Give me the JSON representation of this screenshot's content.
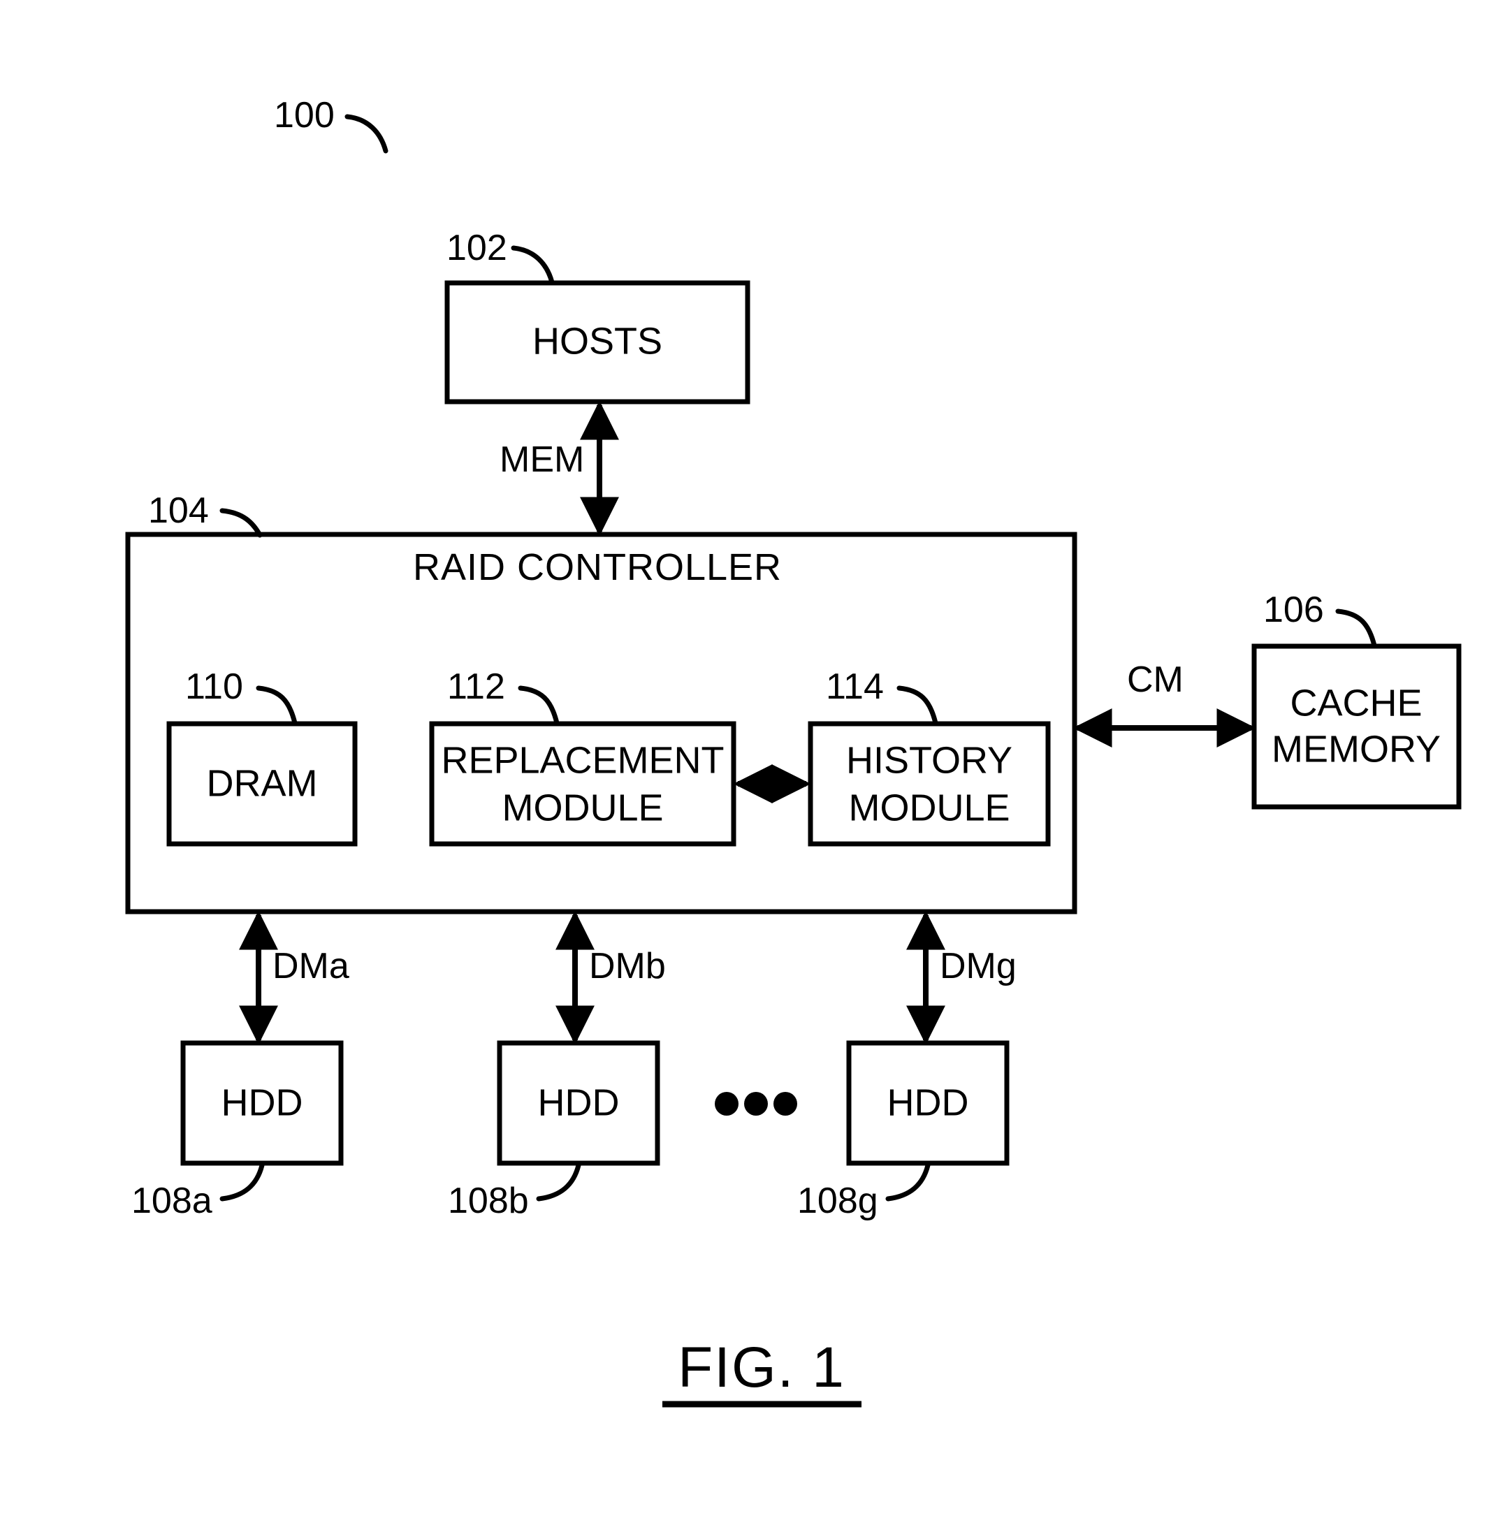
{
  "figure": {
    "caption": "FIG. 1",
    "system_ref": "100"
  },
  "blocks": {
    "hosts": {
      "label": "HOSTS",
      "ref": "102"
    },
    "raid_controller": {
      "label": "RAID CONTROLLER",
      "ref": "104"
    },
    "cache_memory": {
      "label_line1": "CACHE",
      "label_line2": "MEMORY",
      "ref": "106"
    },
    "dram": {
      "label": "DRAM",
      "ref": "110"
    },
    "replacement_module": {
      "label_line1": "REPLACEMENT",
      "label_line2": "MODULE",
      "ref": "112"
    },
    "history_module": {
      "label_line1": "HISTORY",
      "label_line2": "MODULE",
      "ref": "114"
    },
    "drives": [
      {
        "label": "HDD",
        "ref": "108a",
        "signal": "DMa"
      },
      {
        "label": "HDD",
        "ref": "108b",
        "signal": "DMb"
      },
      {
        "label": "HDD",
        "ref": "108g",
        "signal": "DMg"
      }
    ],
    "drive_ellipsis": "• • •"
  },
  "connections": {
    "hosts_to_controller": "MEM",
    "controller_to_cache": "CM",
    "drive_a": "DMa",
    "drive_b": "DMb",
    "drive_g": "DMg"
  },
  "colors": {
    "ink": "#000000",
    "paper": "#ffffff"
  }
}
